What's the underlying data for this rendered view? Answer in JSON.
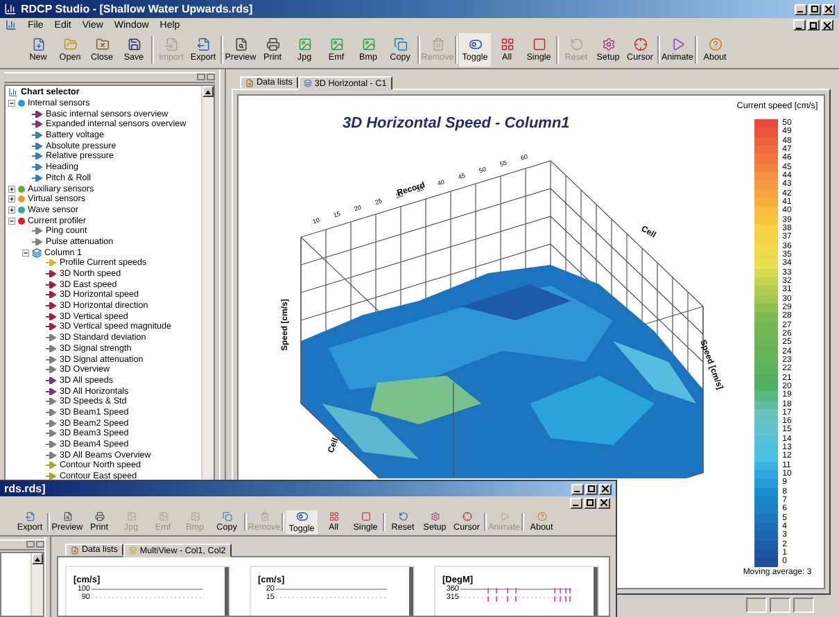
{
  "window": {
    "title": "RDCP Studio - [Shallow Water Upwards.rds]"
  },
  "menu": [
    "File",
    "Edit",
    "View",
    "Window",
    "Help"
  ],
  "toolbar": [
    {
      "label": "New",
      "kind": "new",
      "disabled": false,
      "pressed": false
    },
    {
      "label": "Open",
      "kind": "open",
      "disabled": false,
      "pressed": false
    },
    {
      "label": "Close",
      "kind": "close",
      "disabled": false,
      "pressed": false
    },
    {
      "label": "Save",
      "kind": "save",
      "disabled": false,
      "pressed": false,
      "sep": true
    },
    {
      "label": "Import",
      "kind": "import",
      "disabled": true,
      "pressed": false
    },
    {
      "label": "Export",
      "kind": "export",
      "disabled": false,
      "pressed": false,
      "sep": true
    },
    {
      "label": "Preview",
      "kind": "preview",
      "disabled": false,
      "pressed": false
    },
    {
      "label": "Print",
      "kind": "print",
      "disabled": false,
      "pressed": false
    },
    {
      "label": "Jpg",
      "kind": "image",
      "disabled": false,
      "pressed": false
    },
    {
      "label": "Emf",
      "kind": "image",
      "disabled": false,
      "pressed": false
    },
    {
      "label": "Bmp",
      "kind": "image",
      "disabled": false,
      "pressed": false
    },
    {
      "label": "Copy",
      "kind": "copy",
      "disabled": false,
      "pressed": false,
      "sep": true
    },
    {
      "label": "Remove",
      "kind": "remove",
      "disabled": true,
      "pressed": false,
      "sep": true
    },
    {
      "label": "Toggle",
      "kind": "toggle",
      "disabled": false,
      "pressed": true
    },
    {
      "label": "All",
      "kind": "all",
      "disabled": false,
      "pressed": false
    },
    {
      "label": "Single",
      "kind": "single",
      "disabled": false,
      "pressed": false,
      "sep": true
    },
    {
      "label": "Reset",
      "kind": "reset",
      "disabled": true,
      "pressed": false
    },
    {
      "label": "Setup",
      "kind": "setup",
      "disabled": false,
      "pressed": false
    },
    {
      "label": "Cursor",
      "kind": "cursor",
      "disabled": false,
      "pressed": false,
      "sep": true
    },
    {
      "label": "Animate",
      "kind": "animate",
      "disabled": false,
      "pressed": false,
      "sep": true
    },
    {
      "label": "About",
      "kind": "about",
      "disabled": false,
      "pressed": false
    }
  ],
  "chart_selector": {
    "title": "Chart selector",
    "tree": [
      {
        "label": "Internal sensors",
        "kind": "group",
        "color": "#1a9ee0",
        "expanded": true,
        "children": [
          {
            "label": "Basic internal sensors overview",
            "kind": "chart",
            "color": "#803080"
          },
          {
            "label": "Expanded internal sensors overview",
            "kind": "chart",
            "color": "#803080"
          },
          {
            "label": "Battery voltage",
            "kind": "chart",
            "color": "#3a80b0"
          },
          {
            "label": "Absolute pressure",
            "kind": "chart",
            "color": "#3a80b0"
          },
          {
            "label": "Relative pressure",
            "kind": "chart",
            "color": "#3a80b0"
          },
          {
            "label": "Heading",
            "kind": "chart",
            "color": "#3a80b0"
          },
          {
            "label": "Pitch & Roll",
            "kind": "chart",
            "color": "#3a80b0"
          }
        ]
      },
      {
        "label": "Auxiliary sensors",
        "kind": "group",
        "color": "#60b030",
        "expanded": false
      },
      {
        "label": "Virtual sensors",
        "kind": "group",
        "color": "#e0a020",
        "expanded": false
      },
      {
        "label": "Wave sensor",
        "kind": "group",
        "color": "#20b0a0",
        "expanded": false
      },
      {
        "label": "Current profiler",
        "kind": "group",
        "color": "#e02020",
        "expanded": true,
        "children": [
          {
            "label": "Ping count",
            "kind": "chart",
            "color": "#808080"
          },
          {
            "label": "Pulse attenuation",
            "kind": "chart",
            "color": "#808080"
          },
          {
            "label": "Column 1",
            "kind": "column",
            "color": "#1a6ec0",
            "expanded": true,
            "children": [
              {
                "label": "Profile Current speeds",
                "kind": "chart",
                "color": "#d8b820"
              },
              {
                "label": "3D North speed",
                "kind": "chart",
                "color": "#a02040"
              },
              {
                "label": "3D East speed",
                "kind": "chart",
                "color": "#a02040"
              },
              {
                "label": "3D Horizontal speed",
                "kind": "chart",
                "color": "#a02040"
              },
              {
                "label": "3D Horizontal direction",
                "kind": "chart",
                "color": "#a02040"
              },
              {
                "label": "3D Vertical speed",
                "kind": "chart",
                "color": "#a02040"
              },
              {
                "label": "3D Vertical speed magnitude",
                "kind": "chart",
                "color": "#a02040"
              },
              {
                "label": "3D Standard deviation",
                "kind": "chart",
                "color": "#808080"
              },
              {
                "label": "3D Signal strength",
                "kind": "chart",
                "color": "#808080"
              },
              {
                "label": "3D Signal attenuation",
                "kind": "chart",
                "color": "#808080"
              },
              {
                "label": "3D Overview",
                "kind": "chart",
                "color": "#808080"
              },
              {
                "label": "3D All speeds",
                "kind": "chart",
                "color": "#803080"
              },
              {
                "label": "3D All Horizontals",
                "kind": "chart",
                "color": "#803080"
              },
              {
                "label": "3D Speeds & Std",
                "kind": "chart",
                "color": "#808080"
              },
              {
                "label": "3D Beam1 Speed",
                "kind": "chart",
                "color": "#808080"
              },
              {
                "label": "3D Beam2 Speed",
                "kind": "chart",
                "color": "#808080"
              },
              {
                "label": "3D Beam3 Speed",
                "kind": "chart",
                "color": "#808080"
              },
              {
                "label": "3D Beam4 Speed",
                "kind": "chart",
                "color": "#808080"
              },
              {
                "label": "3D All Beams Overview",
                "kind": "chart",
                "color": "#808080"
              },
              {
                "label": "Contour North speed",
                "kind": "chart",
                "color": "#a0b020"
              },
              {
                "label": "Contour East speed",
                "kind": "chart",
                "color": "#a0b020"
              }
            ]
          }
        ]
      }
    ]
  },
  "tabs": [
    {
      "label": "Data lists",
      "selected": false
    },
    {
      "label": "3D Horizontal - C1",
      "selected": true
    }
  ],
  "chart": {
    "title": "3D Horizontal Speed - Column1",
    "record_axis": "Record",
    "record_ticks": [
      "10",
      "15",
      "20",
      "25",
      "30",
      "35",
      "40",
      "45",
      "50",
      "55",
      "60"
    ],
    "cell_axes": [
      "Cell",
      "Cell"
    ],
    "speed_axes": [
      "Speed [cm/s]",
      "Speed [cm/s]"
    ]
  },
  "legend": {
    "title": "Current speed [cm/s]",
    "values": [
      "50",
      "49",
      "48",
      "47",
      "46",
      "45",
      "44",
      "43",
      "42",
      "41",
      "40",
      "39",
      "38",
      "37",
      "36",
      "35",
      "34",
      "33",
      "32",
      "31",
      "30",
      "29",
      "28",
      "27",
      "26",
      "25",
      "24",
      "23",
      "22",
      "21",
      "20",
      "19",
      "18",
      "17",
      "16",
      "15",
      "14",
      "13",
      "12",
      "11",
      "10",
      "9",
      "8",
      "7",
      "6",
      "5",
      "4",
      "3",
      "2",
      "1",
      "0"
    ],
    "note": "Moving average: 3"
  },
  "second_window": {
    "title": "rds.rds]",
    "toolbar": [
      {
        "label": "Export",
        "kind": "export",
        "disabled": false,
        "pressed": false,
        "sep": true
      },
      {
        "label": "Preview",
        "kind": "preview",
        "disabled": false,
        "pressed": false
      },
      {
        "label": "Print",
        "kind": "print",
        "disabled": false,
        "pressed": false
      },
      {
        "label": "Jpg",
        "kind": "image",
        "disabled": true,
        "pressed": false
      },
      {
        "label": "Emf",
        "kind": "image",
        "disabled": true,
        "pressed": false
      },
      {
        "label": "Bmp",
        "kind": "image",
        "disabled": true,
        "pressed": false
      },
      {
        "label": "Copy",
        "kind": "copy",
        "disabled": false,
        "pressed": false,
        "sep": true
      },
      {
        "label": "Remove",
        "kind": "remove",
        "disabled": true,
        "pressed": false,
        "sep": true
      },
      {
        "label": "Toggle",
        "kind": "toggle",
        "disabled": false,
        "pressed": true
      },
      {
        "label": "All",
        "kind": "all",
        "disabled": false,
        "pressed": false
      },
      {
        "label": "Single",
        "kind": "single",
        "disabled": false,
        "pressed": false,
        "sep": true
      },
      {
        "label": "Reset",
        "kind": "reset",
        "disabled": false,
        "pressed": false
      },
      {
        "label": "Setup",
        "kind": "setup",
        "disabled": false,
        "pressed": false
      },
      {
        "label": "Cursor",
        "kind": "cursor",
        "disabled": false,
        "pressed": false,
        "sep": true
      },
      {
        "label": "Animate",
        "kind": "animate",
        "disabled": true,
        "pressed": false,
        "sep": true
      },
      {
        "label": "About",
        "kind": "about",
        "disabled": false,
        "pressed": false
      }
    ],
    "tabs": [
      {
        "label": "Data lists",
        "selected": false
      },
      {
        "label": "MultiView - Col1, Col2",
        "selected": true
      }
    ],
    "panels": [
      {
        "unit": "[cm/s]",
        "ticks": [
          "100",
          "90"
        ],
        "kind": "speed"
      },
      {
        "unit": "[cm/s]",
        "ticks": [
          "20",
          "15"
        ],
        "kind": "speed"
      },
      {
        "unit": "[DegM]",
        "ticks": [
          "360",
          "315"
        ],
        "kind": "direction"
      }
    ]
  }
}
